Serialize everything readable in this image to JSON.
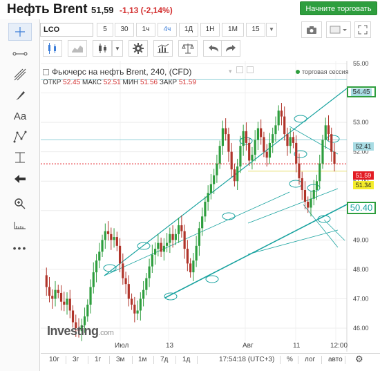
{
  "header": {
    "title": "Нефть Brent",
    "price": "51,59",
    "change": "-1,13 (-2,14%)",
    "trade_button": "Начните торговать"
  },
  "toolbar": {
    "symbol": "LCO",
    "timeframes": [
      "5",
      "30",
      "1ч",
      "4ч",
      "1Д",
      "1Н",
      "1М",
      "15"
    ],
    "active_timeframe": "4ч"
  },
  "legend": {
    "title": "Фьючерс на нефть Brent, 240, (CFD)",
    "open_label": "ОТКР",
    "open": "52.45",
    "high_label": "МАКС",
    "high": "52.51",
    "low_label": "МИН",
    "low": "51.56",
    "close_label": "ЗАКР",
    "close": "51.59",
    "session": "торговая сессия"
  },
  "price_tags": {
    "upper_box": "54.45",
    "t1": "52.41",
    "t2": "51.59",
    "t3": "51.34",
    "lower_box": "50.40"
  },
  "colors": {
    "up": "#2e9e3e",
    "down": "#b0342a",
    "line": "#1aa3a0",
    "accent": "#3b7dd8",
    "trade": "#2e9e3e"
  },
  "chart_data": {
    "type": "candlestick",
    "y_ticks": [
      "55.00",
      "54.00",
      "53.00",
      "52.00",
      "51.00",
      "50.00",
      "49.00",
      "48.00",
      "47.00",
      "46.00"
    ],
    "x_ticks": [
      "Июл",
      "13",
      "Авг",
      "11",
      "12:00"
    ],
    "ylim": [
      45.7,
      55.3
    ],
    "last_price": 51.59
  },
  "logo": {
    "brand": "Investing",
    "suffix": ".com"
  },
  "bottom": {
    "ranges": [
      "10г",
      "3г",
      "1г",
      "3м",
      "1м",
      "7д",
      "1д"
    ],
    "time": "17:54:18 (UTC+3)",
    "options": [
      "%",
      "лог",
      "авто"
    ]
  }
}
